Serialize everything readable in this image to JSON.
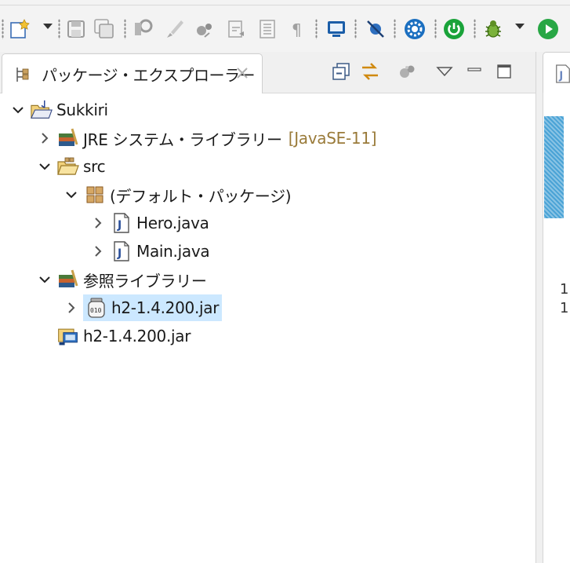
{
  "view": {
    "tab_title": "パッケージ・エクスプローラー",
    "tab_icon": "package-explorer-icon"
  },
  "toolbar": {
    "icons": [
      "new-wizard-icon",
      "save-icon",
      "save-all-icon",
      "search-icon",
      "brush-icon",
      "toggle-ant-icon",
      "task-icon",
      "outline-icon",
      "pilcrow-icon",
      "console-icon",
      "breakpoint-skip-icon",
      "settings-gear-icon",
      "power-icon",
      "debug-bug-icon",
      "run-icon"
    ]
  },
  "view_toolbar": {
    "icons": [
      "collapse-all-icon",
      "link-with-editor-icon",
      "focus-icon",
      "view-menu-icon",
      "minimize-icon",
      "maximize-icon"
    ]
  },
  "tree": {
    "project": "Sukkiri",
    "jre": {
      "label": "JRE システム・ライブラリー",
      "decoration": "[JavaSE-11]"
    },
    "src": "src",
    "default_package": "(デフォルト・パッケージ)",
    "files": [
      "Hero.java",
      "Main.java"
    ],
    "referenced_libraries": "参照ライブラリー",
    "library_jar": "h2-1.4.200.jar",
    "root_jar": "h2-1.4.200.jar"
  },
  "editor_strip": {
    "line_numbers": [
      "1",
      "1"
    ]
  },
  "colors": {
    "selection": "#cce8ff",
    "decoration": "#9a7b3a",
    "accent_blue": "#1a6fb3"
  }
}
